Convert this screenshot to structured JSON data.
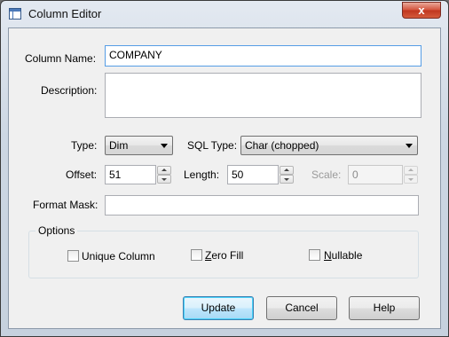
{
  "window": {
    "title": "Column Editor",
    "close_glyph": "x"
  },
  "form": {
    "column_name": {
      "label": "Column Name:",
      "value": "COMPANY"
    },
    "description": {
      "label": "Description:",
      "value": ""
    },
    "type": {
      "label": "Type:",
      "value": "Dim"
    },
    "sql_type": {
      "label": "SQL Type:",
      "value": "Char (chopped)"
    },
    "offset": {
      "label": "Offset:",
      "value": "51"
    },
    "length": {
      "label": "Length:",
      "value": "50"
    },
    "scale": {
      "label": "Scale:",
      "value": "0",
      "enabled": false
    },
    "format_mask": {
      "label": "Format Mask:",
      "value": ""
    }
  },
  "options": {
    "title": "Options",
    "unique_column": {
      "label": "Unique Column",
      "checked": false
    },
    "zero_fill": {
      "label_underlined": "Z",
      "label_rest": "ero Fill",
      "checked": false
    },
    "nullable": {
      "label_underlined": "N",
      "label_rest": "ullable",
      "checked": false
    }
  },
  "buttons": {
    "update": "Update",
    "cancel": "Cancel",
    "help": "Help"
  },
  "colors": {
    "focus_border": "#569de5",
    "close_button": "#c0361f",
    "default_button": "#bee6fd"
  }
}
